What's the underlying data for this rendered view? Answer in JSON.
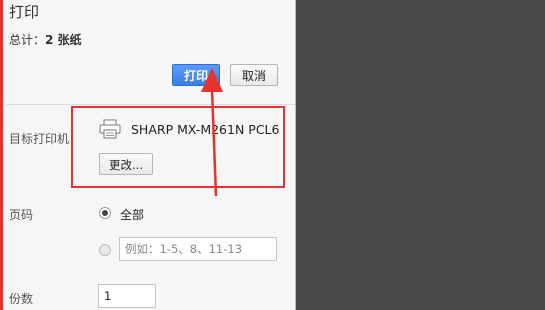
{
  "dialog": {
    "title": "打印",
    "summary_prefix": "总计：",
    "summary_value": "2 张纸"
  },
  "buttons": {
    "print": "打印",
    "cancel": "取消",
    "change": "更改..."
  },
  "destination": {
    "label": "目标打印机",
    "printer_name": "SHARP MX-M261N PCL6",
    "icon": "printer-icon"
  },
  "pages": {
    "label": "页码",
    "option_all": "全部",
    "option_all_selected": true,
    "custom_placeholder": "例如：1-5、8、11-13"
  },
  "copies": {
    "label": "份数",
    "value": "1"
  },
  "annotation": {
    "color": "#e8322d"
  }
}
